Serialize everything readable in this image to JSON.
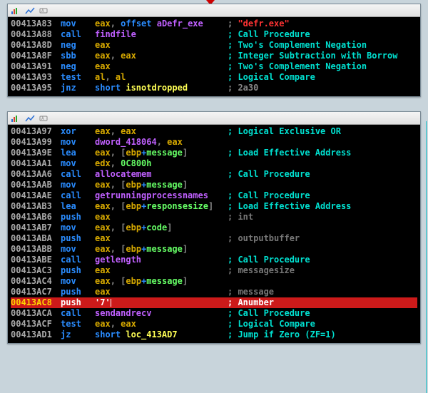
{
  "top_panel": {
    "rows": [
      {
        "addr": "00413A83",
        "mn": "mov",
        "op": [
          {
            "t": "eax",
            "c": "gold"
          },
          {
            "t": ", ",
            "c": "text"
          },
          {
            "t": "offset ",
            "c": "blue"
          },
          {
            "t": "aDefr_exe",
            "c": "magenta"
          }
        ],
        "cm": [
          {
            "t": "; ",
            "c": "text"
          },
          {
            "t": "\"defr.exe\"",
            "c": "red"
          }
        ]
      },
      {
        "addr": "00413A88",
        "mn": "call",
        "op": [
          {
            "t": "findfile",
            "c": "magenta"
          }
        ],
        "cm": [
          {
            "t": "; Call Procedure",
            "c": "cyan"
          }
        ]
      },
      {
        "addr": "00413A8D",
        "mn": "neg",
        "op": [
          {
            "t": "eax",
            "c": "gold"
          }
        ],
        "cm": [
          {
            "t": "; Two's Complement Negation",
            "c": "cyan"
          }
        ]
      },
      {
        "addr": "00413A8F",
        "mn": "sbb",
        "op": [
          {
            "t": "eax",
            "c": "gold"
          },
          {
            "t": ", ",
            "c": "text"
          },
          {
            "t": "eax",
            "c": "gold"
          }
        ],
        "cm": [
          {
            "t": "; Integer Subtraction with Borrow",
            "c": "cyan"
          }
        ]
      },
      {
        "addr": "00413A91",
        "mn": "neg",
        "op": [
          {
            "t": "eax",
            "c": "gold"
          }
        ],
        "cm": [
          {
            "t": "; Two's Complement Negation",
            "c": "cyan"
          }
        ]
      },
      {
        "addr": "00413A93",
        "mn": "test",
        "op": [
          {
            "t": "al",
            "c": "gold"
          },
          {
            "t": ", ",
            "c": "text"
          },
          {
            "t": "al",
            "c": "gold"
          }
        ],
        "cm": [
          {
            "t": "; Logical Compare",
            "c": "cyan"
          }
        ]
      },
      {
        "addr": "00413A95",
        "mn": "jnz",
        "op": [
          {
            "t": "short ",
            "c": "blue"
          },
          {
            "t": "isnotdropped",
            "c": "yellow"
          }
        ],
        "cm": [
          {
            "t": "; 2a30",
            "c": "text"
          }
        ]
      }
    ]
  },
  "bottom_panel": {
    "rows": [
      {
        "addr": "00413A97",
        "mn": "xor",
        "op": [
          {
            "t": "eax",
            "c": "gold"
          },
          {
            "t": ", ",
            "c": "text"
          },
          {
            "t": "eax",
            "c": "gold"
          }
        ],
        "cm": [
          {
            "t": "; Logical Exclusive OR",
            "c": "cyan"
          }
        ]
      },
      {
        "addr": "00413A99",
        "mn": "mov",
        "op": [
          {
            "t": "dword_418064",
            "c": "magenta"
          },
          {
            "t": ", ",
            "c": "text"
          },
          {
            "t": "eax",
            "c": "gold"
          }
        ],
        "cm": []
      },
      {
        "addr": "00413A9E",
        "mn": "lea",
        "op": [
          {
            "t": "eax",
            "c": "gold"
          },
          {
            "t": ", [",
            "c": "text"
          },
          {
            "t": "ebp",
            "c": "gold"
          },
          {
            "t": "+",
            "c": "blue"
          },
          {
            "t": "message",
            "c": "lgreen"
          },
          {
            "t": "]",
            "c": "text"
          }
        ],
        "cm": [
          {
            "t": "; Load Effective Address",
            "c": "cyan"
          }
        ]
      },
      {
        "addr": "00413AA1",
        "mn": "mov",
        "op": [
          {
            "t": "edx",
            "c": "gold"
          },
          {
            "t": ", ",
            "c": "text"
          },
          {
            "t": "0C800h",
            "c": "lgreen"
          }
        ],
        "cm": []
      },
      {
        "addr": "00413AA6",
        "mn": "call",
        "op": [
          {
            "t": "allocatemem",
            "c": "magenta"
          }
        ],
        "cm": [
          {
            "t": "; Call Procedure",
            "c": "cyan"
          }
        ]
      },
      {
        "addr": "00413AAB",
        "mn": "mov",
        "op": [
          {
            "t": "eax",
            "c": "gold"
          },
          {
            "t": ", [",
            "c": "text"
          },
          {
            "t": "ebp",
            "c": "gold"
          },
          {
            "t": "+",
            "c": "blue"
          },
          {
            "t": "message",
            "c": "lgreen"
          },
          {
            "t": "]",
            "c": "text"
          }
        ],
        "cm": []
      },
      {
        "addr": "00413AAE",
        "mn": "call",
        "op": [
          {
            "t": "getrunningprocessnames",
            "c": "magenta"
          }
        ],
        "cm": [
          {
            "t": "; Call Procedure",
            "c": "cyan"
          }
        ]
      },
      {
        "addr": "00413AB3",
        "mn": "lea",
        "op": [
          {
            "t": "eax",
            "c": "gold"
          },
          {
            "t": ", [",
            "c": "text"
          },
          {
            "t": "ebp",
            "c": "gold"
          },
          {
            "t": "+",
            "c": "blue"
          },
          {
            "t": "responsesize",
            "c": "lgreen"
          },
          {
            "t": "]",
            "c": "text"
          }
        ],
        "cm": [
          {
            "t": "; Load Effective Address",
            "c": "cyan"
          }
        ]
      },
      {
        "addr": "00413AB6",
        "mn": "push",
        "op": [
          {
            "t": "eax",
            "c": "gold"
          }
        ],
        "cm": [
          {
            "t": "; int",
            "c": "dim"
          }
        ]
      },
      {
        "addr": "00413AB7",
        "mn": "mov",
        "op": [
          {
            "t": "eax",
            "c": "gold"
          },
          {
            "t": ", [",
            "c": "text"
          },
          {
            "t": "ebp",
            "c": "gold"
          },
          {
            "t": "+",
            "c": "blue"
          },
          {
            "t": "code",
            "c": "lgreen"
          },
          {
            "t": "]",
            "c": "text"
          }
        ],
        "cm": []
      },
      {
        "addr": "00413ABA",
        "mn": "push",
        "op": [
          {
            "t": "eax",
            "c": "gold"
          }
        ],
        "cm": [
          {
            "t": "; outputbuffer",
            "c": "dim"
          }
        ]
      },
      {
        "addr": "00413ABB",
        "mn": "mov",
        "op": [
          {
            "t": "eax",
            "c": "gold"
          },
          {
            "t": ", [",
            "c": "text"
          },
          {
            "t": "ebp",
            "c": "gold"
          },
          {
            "t": "+",
            "c": "blue"
          },
          {
            "t": "message",
            "c": "lgreen"
          },
          {
            "t": "]",
            "c": "text"
          }
        ],
        "cm": []
      },
      {
        "addr": "00413ABE",
        "mn": "call",
        "op": [
          {
            "t": "getlength",
            "c": "magenta"
          }
        ],
        "cm": [
          {
            "t": "; Call Procedure",
            "c": "cyan"
          }
        ]
      },
      {
        "addr": "00413AC3",
        "mn": "push",
        "op": [
          {
            "t": "eax",
            "c": "gold"
          }
        ],
        "cm": [
          {
            "t": "; messagesize",
            "c": "dim"
          }
        ]
      },
      {
        "addr": "00413AC4",
        "mn": "mov",
        "op": [
          {
            "t": "eax",
            "c": "gold"
          },
          {
            "t": ", [",
            "c": "text"
          },
          {
            "t": "ebp",
            "c": "gold"
          },
          {
            "t": "+",
            "c": "blue"
          },
          {
            "t": "message",
            "c": "lgreen"
          },
          {
            "t": "]",
            "c": "text"
          }
        ],
        "cm": []
      },
      {
        "addr": "00413AC7",
        "mn": "push",
        "op": [
          {
            "t": "eax",
            "c": "gold"
          }
        ],
        "cm": [
          {
            "t": "; message",
            "c": "dim"
          }
        ]
      },
      {
        "addr": "00413AC8",
        "mn": "push",
        "op": [
          {
            "t": "'7'",
            "c": "white"
          }
        ],
        "cm": [
          {
            "t": "; Anumber",
            "c": "white"
          }
        ],
        "hl": true,
        "cursor": true
      },
      {
        "addr": "00413ACA",
        "mn": "call",
        "op": [
          {
            "t": "sendandrecv",
            "c": "magenta"
          }
        ],
        "cm": [
          {
            "t": "; Call Procedure",
            "c": "cyan"
          }
        ]
      },
      {
        "addr": "00413ACF",
        "mn": "test",
        "op": [
          {
            "t": "eax",
            "c": "gold"
          },
          {
            "t": ", ",
            "c": "text"
          },
          {
            "t": "eax",
            "c": "gold"
          }
        ],
        "cm": [
          {
            "t": "; Logical Compare",
            "c": "cyan"
          }
        ]
      },
      {
        "addr": "00413AD1",
        "mn": "jz",
        "op": [
          {
            "t": "short ",
            "c": "blue"
          },
          {
            "t": "loc_413AD7",
            "c": "yellow"
          }
        ],
        "cm": [
          {
            "t": "; Jump if Zero (ZF=1)",
            "c": "cyan"
          }
        ]
      }
    ]
  }
}
